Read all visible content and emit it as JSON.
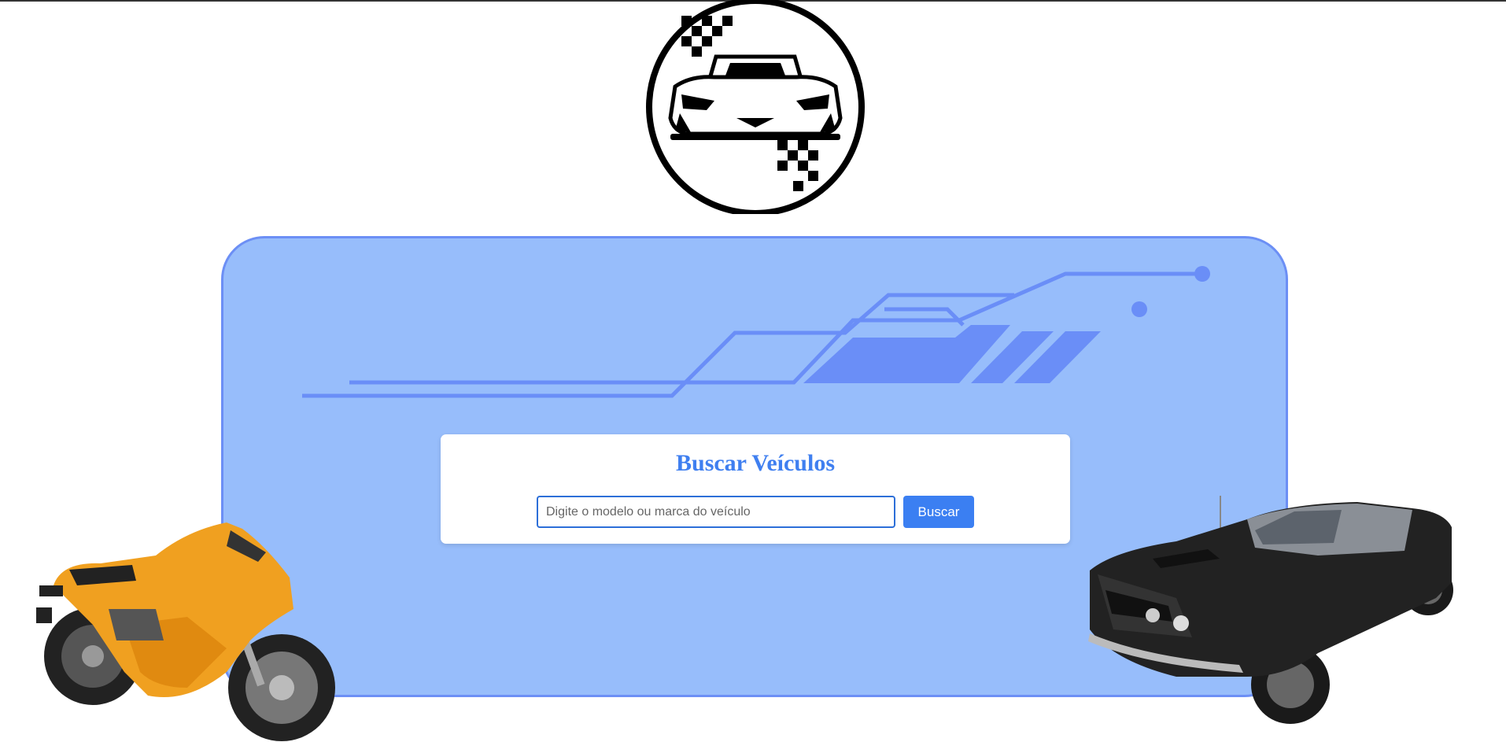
{
  "logo": {
    "icon": "racing-car-checkered-flag-logo"
  },
  "search": {
    "title": "Buscar Veículos",
    "placeholder": "Digite o modelo ou marca do veículo",
    "value": "",
    "button_label": "Buscar"
  },
  "images": {
    "left": "orange-sport-motorcycle",
    "right": "black-muscle-car"
  },
  "colors": {
    "panel_bg": "#97bdfb",
    "panel_border": "#6c8ff5",
    "accent": "#3b7ff2",
    "title": "#3f7ff0"
  }
}
